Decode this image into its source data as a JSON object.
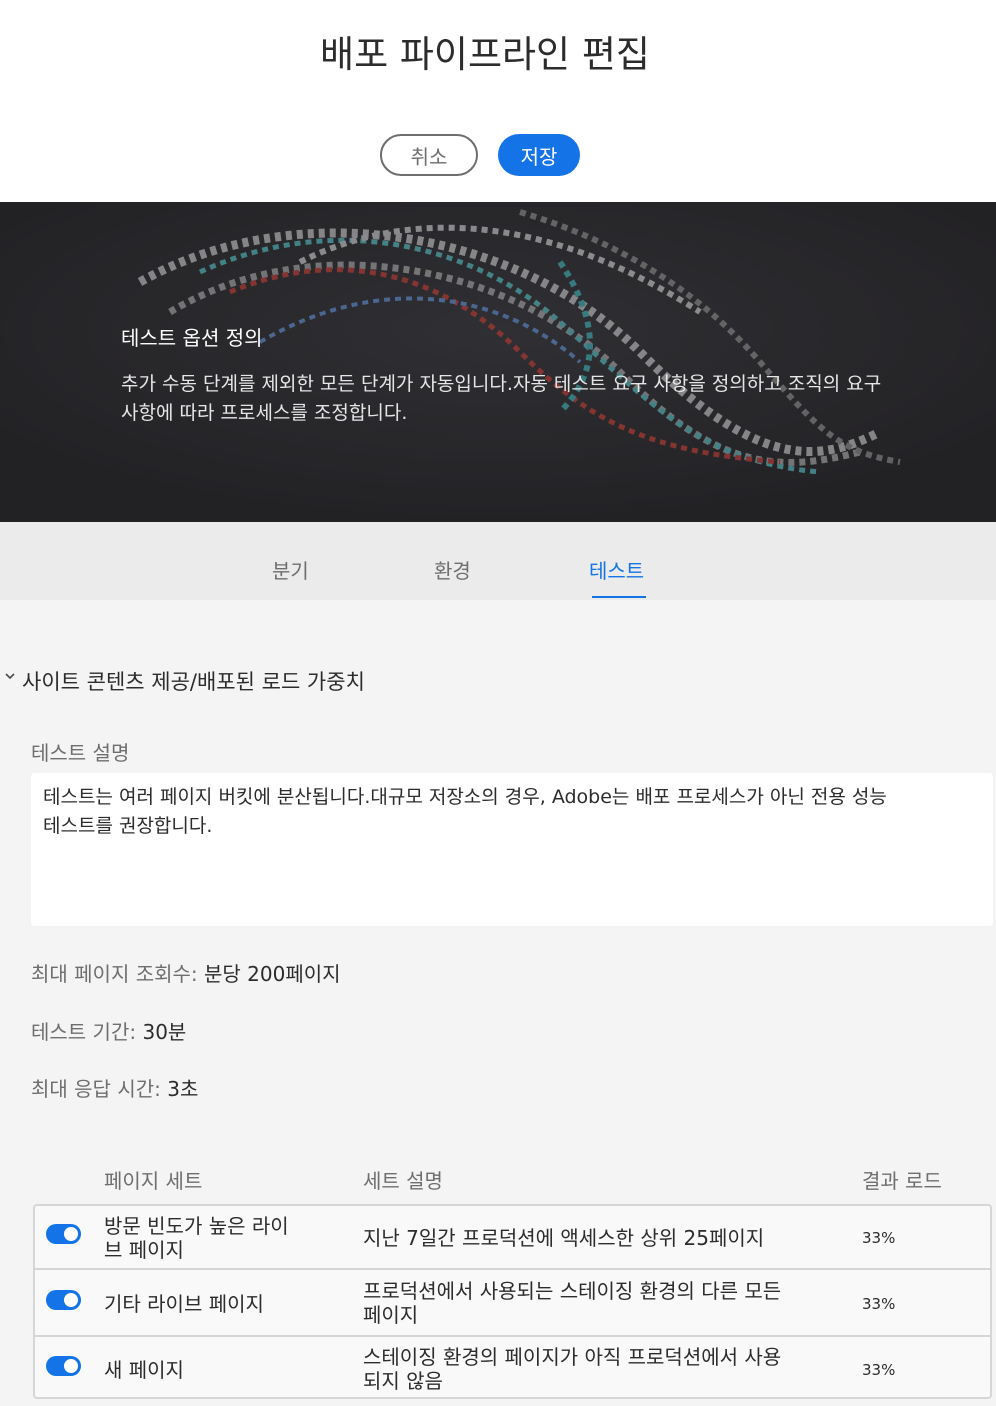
{
  "header": {
    "title": "배포 파이프라인 편집",
    "cancel_label": "취소",
    "save_label": "저장"
  },
  "hero": {
    "title": "테스트 옵션 정의",
    "description": "추가 수동 단계를 제외한 모든 단계가 자동입니다.자동 테스트 요구 사항을 정의하고 조직의 요구 사항에 따라 프로세스를 조정합니다."
  },
  "tabs": [
    {
      "label": "분기"
    },
    {
      "label": "환경"
    },
    {
      "label": "테스트"
    }
  ],
  "section": {
    "title": "사이트 콘텐츠 제공/배포된 로드 가중치",
    "description_label": "테스트 설명",
    "description_text": "테스트는 여러 페이지 버킷에 분산됩니다.대규모 저장소의 경우, Adobe는 배포 프로세스가 아닌 전용 성능 테스트를 권장합니다."
  },
  "settings": [
    {
      "label": "최대 페이지 조회수:",
      "value": " 분당 200페이지"
    },
    {
      "label": "테스트 기간:",
      "value": " 30분"
    },
    {
      "label": "최대 응답 시간:",
      "value": " 3초"
    }
  ],
  "table": {
    "headers": {
      "set": "페이지 세트",
      "description": "세트 설명",
      "load": "결과 로드"
    },
    "rows": [
      {
        "enabled": true,
        "name": "방문 빈도가 높은 라이브 페이지",
        "description": "지난 7일간 프로덕션에 액세스한 상위 25페이지",
        "load": "33%"
      },
      {
        "enabled": true,
        "name": "기타 라이브 페이지",
        "description": "프로덕션에서 사용되는 스테이징 환경의 다른 모든 페이지",
        "load": "33%"
      },
      {
        "enabled": true,
        "name": "새 페이지",
        "description": "스테이징 환경의 페이지가 아직 프로덕션에서 사용되지 않음",
        "load": "33%"
      }
    ]
  },
  "colors": {
    "accent": "#1473e6",
    "hero_bg": "#2a292c"
  },
  "icons": {
    "section_toggle": "chevron-down-icon"
  }
}
